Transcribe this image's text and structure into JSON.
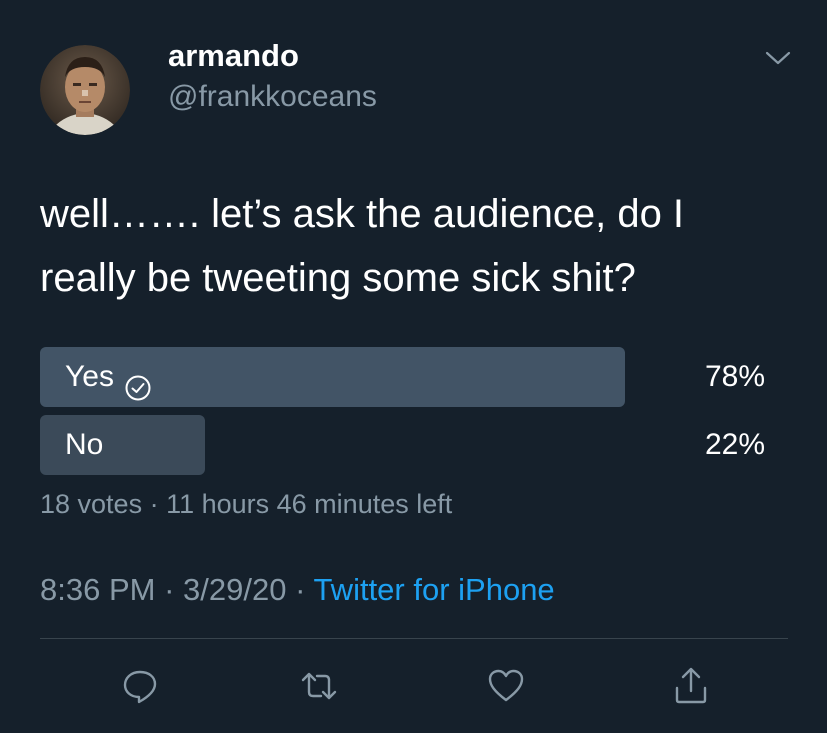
{
  "user": {
    "display_name": "armando",
    "handle": "@frankkoceans"
  },
  "tweet": {
    "text_line1": "well……. let’s ask the audience, do I",
    "text_line2": "really be tweeting some sick shit?"
  },
  "poll": {
    "options": [
      {
        "label": "Yes",
        "percent_text": "78%",
        "percent": 78,
        "selected": true
      },
      {
        "label": "No",
        "percent_text": "22%",
        "percent": 22,
        "selected": false
      }
    ],
    "votes": "18 votes",
    "separator": " · ",
    "time_left": "11 hours 46 minutes left"
  },
  "meta": {
    "time": "8:36 PM",
    "date": "3/29/20",
    "separator": " · ",
    "source": "Twitter for iPhone"
  },
  "icons": {
    "more": "chevron-down-icon",
    "check": "check-circle-icon",
    "reply": "reply-icon",
    "retweet": "retweet-icon",
    "like": "heart-icon",
    "share": "share-icon"
  },
  "colors": {
    "background": "#15202b",
    "secondary_text": "#8899a6",
    "link": "#1da1f2",
    "poll_winner": "#425466",
    "poll_other": "#3b4a59"
  }
}
